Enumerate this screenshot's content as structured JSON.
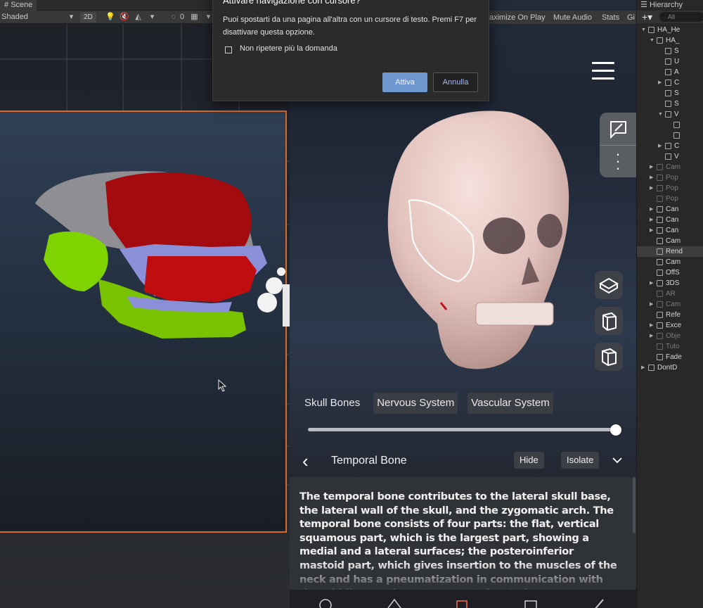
{
  "scene": {
    "tab_label": "Scene",
    "shading_mode": "Shaded",
    "mode_2d": "2D",
    "gizmo_count": "0"
  },
  "game": {
    "toolbar_items": [
      "aximize On Play",
      "Mute Audio",
      "Stats",
      "Gi"
    ],
    "layer_tabs": [
      "Skull Bones",
      "Nervous System",
      "Vascular System"
    ],
    "active_layer": "Skull Bones",
    "opacity_level": 1.0,
    "bone_title": "Temporal Bone",
    "hide_label": "Hide",
    "isolate_label": "Isolate",
    "description": "The temporal bone contributes to the lateral skull base, the lateral wall of the skull, and the zygomatic arch. The temporal bone consists of four parts: the flat, vertical squamous part, which is the largest part, showing a medial and a lateral surfaces; the posteroinferior mastoid part, which gives insertion to the muscles of the neck and has a pneumatization in communication with the middle ear: the petrous part, located",
    "icons": {
      "menu": "hamburger-menu-icon",
      "annotate": "annotate-note-icon",
      "more": "more-vertical-icon",
      "views": [
        "perspective-cube-icon",
        "side-cube-icon",
        "front-cube-icon"
      ],
      "back": "chevron-left-icon",
      "expand": "chevron-down-icon"
    }
  },
  "dialog": {
    "title": "Attivare navigazione con cursore?",
    "message": "Puoi spostarti da una pagina all'altra con un cursore di testo. Premi F7 per disattivare questa opzione.",
    "checkbox_label": "Non ripetere più la domanda",
    "ok_label": "Attiva",
    "cancel_label": "Annulla"
  },
  "hierarchy": {
    "tab_label": "Hierarchy",
    "search_placeholder": "All",
    "items": [
      {
        "label": "HA_He",
        "dim": false,
        "indent": 0,
        "arrow": "▼",
        "selected": false
      },
      {
        "label": "HA_",
        "dim": false,
        "indent": 1,
        "arrow": "▼",
        "selected": false
      },
      {
        "label": "S",
        "dim": false,
        "indent": 2,
        "arrow": "",
        "selected": false
      },
      {
        "label": "U",
        "dim": false,
        "indent": 2,
        "arrow": "",
        "selected": false
      },
      {
        "label": "A",
        "dim": false,
        "indent": 2,
        "arrow": "",
        "selected": false
      },
      {
        "label": "C",
        "dim": false,
        "indent": 2,
        "arrow": "▶",
        "selected": false
      },
      {
        "label": "S",
        "dim": false,
        "indent": 2,
        "arrow": "",
        "selected": false
      },
      {
        "label": "S",
        "dim": false,
        "indent": 2,
        "arrow": "",
        "selected": false
      },
      {
        "label": "V",
        "dim": false,
        "indent": 2,
        "arrow": "▼",
        "selected": false
      },
      {
        "label": "",
        "dim": false,
        "indent": 3,
        "arrow": "",
        "selected": false
      },
      {
        "label": "",
        "dim": false,
        "indent": 3,
        "arrow": "",
        "selected": false
      },
      {
        "label": "C",
        "dim": false,
        "indent": 2,
        "arrow": "▶",
        "selected": false
      },
      {
        "label": "V",
        "dim": false,
        "indent": 2,
        "arrow": "",
        "selected": false
      },
      {
        "label": "Cam",
        "dim": true,
        "indent": 1,
        "arrow": "▶",
        "selected": false
      },
      {
        "label": "Pop",
        "dim": true,
        "indent": 1,
        "arrow": "▶",
        "selected": false
      },
      {
        "label": "Pop",
        "dim": true,
        "indent": 1,
        "arrow": "▶",
        "selected": false
      },
      {
        "label": "Pop",
        "dim": true,
        "indent": 1,
        "arrow": "",
        "selected": false
      },
      {
        "label": "Can",
        "dim": false,
        "indent": 1,
        "arrow": "▶",
        "selected": false
      },
      {
        "label": "Can",
        "dim": false,
        "indent": 1,
        "arrow": "▶",
        "selected": false
      },
      {
        "label": "Can",
        "dim": false,
        "indent": 1,
        "arrow": "▶",
        "selected": false
      },
      {
        "label": "Cam",
        "dim": false,
        "indent": 1,
        "arrow": "",
        "selected": false
      },
      {
        "label": "Rend",
        "dim": false,
        "indent": 1,
        "arrow": "",
        "selected": true
      },
      {
        "label": "Cam",
        "dim": false,
        "indent": 1,
        "arrow": "",
        "selected": false
      },
      {
        "label": "OffS",
        "dim": false,
        "indent": 1,
        "arrow": "",
        "selected": false
      },
      {
        "label": "3DS",
        "dim": false,
        "indent": 1,
        "arrow": "▶",
        "selected": false
      },
      {
        "label": "AR",
        "dim": true,
        "indent": 1,
        "arrow": "",
        "selected": false
      },
      {
        "label": "Cam",
        "dim": true,
        "indent": 1,
        "arrow": "▶",
        "selected": false
      },
      {
        "label": "Refe",
        "dim": false,
        "indent": 1,
        "arrow": "",
        "selected": false
      },
      {
        "label": "Exce",
        "dim": false,
        "indent": 1,
        "arrow": "▶",
        "selected": false
      },
      {
        "label": "Obje",
        "dim": true,
        "indent": 1,
        "arrow": "▶",
        "selected": false
      },
      {
        "label": "Tuto",
        "dim": true,
        "indent": 1,
        "arrow": "",
        "selected": false
      },
      {
        "label": "Fade",
        "dim": false,
        "indent": 1,
        "arrow": "",
        "selected": false
      },
      {
        "label": "DontD",
        "dim": false,
        "indent": 0,
        "arrow": "▶",
        "selected": false
      }
    ]
  },
  "colors": {
    "frame_outline": "#d7692b",
    "skull_red": "#a30b0e",
    "skull_green": "#7fd300",
    "skull_lilac": "#8a8fd8",
    "skull_grey": "#8f8f93",
    "skull_bone": "#e8cbc6",
    "dialog_ok": "#6e96cf"
  }
}
